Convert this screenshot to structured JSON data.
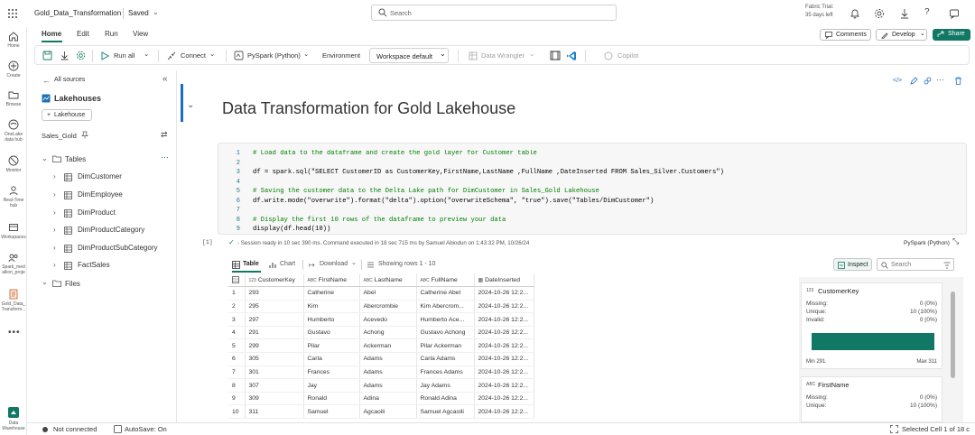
{
  "app": {
    "doc_title": "Gold_Data_Transformation",
    "saved_label": "Saved",
    "search_placeholder": "Search",
    "trial_line1": "Fabric Trial:",
    "trial_line2": "35 days left",
    "accent": "#117865"
  },
  "leftnav": [
    {
      "label": "Home",
      "icon": "home-icon"
    },
    {
      "label": "Create",
      "icon": "plus-circle-icon"
    },
    {
      "label": "Browse",
      "icon": "folder-icon"
    },
    {
      "label": "OneLake data hub",
      "icon": "onelake-icon"
    },
    {
      "label": "Monitor",
      "icon": "monitor-icon"
    },
    {
      "label": "Real-Time hub",
      "icon": "realtime-icon"
    },
    {
      "label": "Workspaces",
      "icon": "workspaces-icon"
    },
    {
      "label": "Spark_medallion_project",
      "icon": "project-icon"
    },
    {
      "label": "Gold_Data_Transform...",
      "icon": "notebook-icon"
    },
    {
      "label": "Data Warehouse",
      "icon": "data-warehouse-icon"
    }
  ],
  "ribbon": {
    "tabs": [
      "Home",
      "Edit",
      "Run",
      "View"
    ],
    "comments": "Comments",
    "develop": "Develop",
    "share": "Share"
  },
  "toolbar": {
    "run_all": "Run all",
    "connect": "Connect",
    "kernel": "PySpark (Python)",
    "environment": "Environment",
    "workspace": "Workspace default",
    "data_wrangler": "Data Wrangler",
    "copilot": "Copilot"
  },
  "explorer": {
    "back": "All sources",
    "heading": "Lakehouses",
    "add": "Lakehouse",
    "lakehouse": "Sales_Gold",
    "tables_label": "Tables",
    "tables": [
      "DimCustomer",
      "DimEmployee",
      "DimProduct",
      "DimProductCategory",
      "DimProductSubCategory",
      "FactSales"
    ],
    "files_label": "Files"
  },
  "notebook": {
    "heading": "Data Transformation for Gold Lakehouse",
    "cell_index": "[1]",
    "code_lines": [
      "# Load data to the dataframe and create the gold layer for Customer table",
      "",
      "df = spark.sql(\"SELECT CustomerID as CustomerKey,FirstName,LastName ,FullName ,DateInserted FROM Sales_Silver.Customers\")",
      "",
      "# Saving the customer data to the Delta Lake path for DimCustomer in Sales_Gold Lakehouse",
      "df.write.mode(\"overwrite\").format(\"delta\").option(\"overwriteSchema\", \"true\").save(\"Tables/DimCustomer\")",
      "",
      "# Display the first 10 rows of the dataframe to preview your data",
      "display(df.head(10))"
    ],
    "status": "- Session ready in 10 sec 390 ms. Command executed in 18 sec 715 ms by Samuel Abiodun on 1:43:32 PM, 10/26/24",
    "kernel_label": "PySpark (Python)"
  },
  "output": {
    "tab_table": "Table",
    "tab_chart": "Chart",
    "download": "Download",
    "showing": "Showing rows 1 - 10",
    "inspect": "Inspect",
    "search_placeholder": "Search",
    "columns": [
      {
        "type": "123",
        "name": "CustomerKey"
      },
      {
        "type": "ABC",
        "name": "FirstName"
      },
      {
        "type": "ABC",
        "name": "LastName"
      },
      {
        "type": "ABC",
        "name": "FullName"
      },
      {
        "type": "cal",
        "name": "DateInserted"
      }
    ],
    "rows": [
      [
        "1",
        "293",
        "Catherine",
        "Abel",
        "Catherine Abel",
        "2024-10-26 12:2..."
      ],
      [
        "2",
        "295",
        "Kim",
        "Abercrombie",
        "Kim Abercrom...",
        "2024-10-26 12:2..."
      ],
      [
        "3",
        "297",
        "Humberto",
        "Acevedo",
        "Humberto Ace...",
        "2024-10-26 12:2..."
      ],
      [
        "4",
        "291",
        "Gustavo",
        "Achong",
        "Gustavo Achong",
        "2024-10-26 12:2..."
      ],
      [
        "5",
        "299",
        "Pilar",
        "Ackerman",
        "Pilar Ackerman",
        "2024-10-26 12:2..."
      ],
      [
        "6",
        "305",
        "Carla",
        "Adams",
        "Carla Adams",
        "2024-10-26 12:2..."
      ],
      [
        "7",
        "301",
        "Frances",
        "Adams",
        "Frances Adams",
        "2024-10-26 12:2..."
      ],
      [
        "8",
        "307",
        "Jay",
        "Adams",
        "Jay Adams",
        "2024-10-26 12:2..."
      ],
      [
        "9",
        "309",
        "Ronald",
        "Adina",
        "Ronald Adina",
        "2024-10-26 12:2..."
      ],
      [
        "10",
        "311",
        "Samuel",
        "Agcaoili",
        "Samuel Agcaoili",
        "2024-10-26 12:2..."
      ]
    ],
    "inspect_panel": {
      "card1": {
        "title": "CustomerKey",
        "missing_label": "Missing:",
        "missing_value": "0 (0%)",
        "unique_label": "Unique:",
        "unique_value": "10 (100%)",
        "invalid_label": "Invalid:",
        "invalid_value": "0 (0%)",
        "min_label": "Min 291",
        "max_label": "Max 311"
      },
      "card2": {
        "title": "FirstName",
        "missing_label": "Missing:",
        "missing_value": "0 (0%)",
        "unique_label": "Unique:",
        "unique_value": "10 (100%)"
      }
    }
  },
  "statusbar": {
    "connection": "Not connected",
    "autosave": "AutoSave: On",
    "selection": "Selected Cell 1 of 18 c"
  }
}
